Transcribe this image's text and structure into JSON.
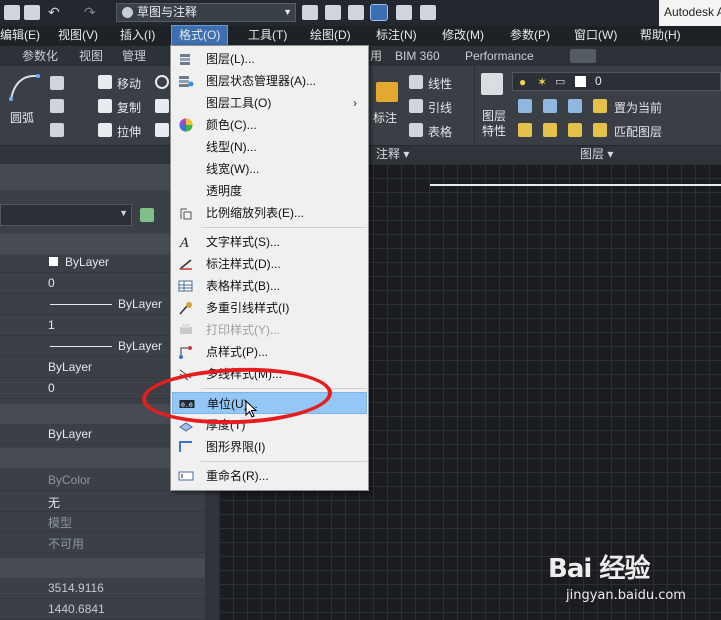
{
  "toolbar": {
    "workspace": "草图与注释",
    "app_title": "Autodesk A"
  },
  "menubar": [
    "编辑(E)",
    "视图(V)",
    "插入(I)",
    "格式(O)",
    "工具(T)",
    "绘图(D)",
    "标注(N)",
    "修改(M)",
    "参数(P)",
    "窗口(W)",
    "帮助(H)"
  ],
  "tabs": [
    "参数化",
    "视图",
    "管理",
    "用",
    "BIM 360",
    "Performance"
  ],
  "ribbon": {
    "arc": "圆弧",
    "move": "移动",
    "copy": "复制",
    "stretch": "拉伸",
    "annotate": "标注",
    "linear": "线性",
    "leader": "引线",
    "table": "表格",
    "layer_props": "图层\n特性",
    "layer_value": "0",
    "set_current": "置为当前",
    "match_layer": "匹配图层",
    "group_annotate": "注释 ▾",
    "group_layer": "图层 ▾"
  },
  "properties": {
    "rows": [
      "ByLayer",
      "0",
      "ByLayer",
      "1",
      "ByLayer",
      "ByLayer",
      "0",
      "ByLayer",
      "ByColor",
      "无",
      "模型",
      "不可用",
      "3514.9116",
      "1440.6841"
    ]
  },
  "format_menu": {
    "items": [
      {
        "label": "图层(L)...",
        "icon": "layer-icon"
      },
      {
        "label": "图层状态管理器(A)...",
        "icon": "layer-state-icon"
      },
      {
        "label": "图层工具(O)",
        "icon": "",
        "submenu": "›"
      },
      {
        "label": "颜色(C)...",
        "icon": "color-wheel-icon"
      },
      {
        "label": "线型(N)...",
        "icon": ""
      },
      {
        "label": "线宽(W)...",
        "icon": ""
      },
      {
        "label": "透明度",
        "icon": ""
      },
      {
        "label": "比例缩放列表(E)...",
        "icon": "scale-list-icon"
      },
      {
        "label": "文字样式(S)...",
        "icon": "text-style-icon"
      },
      {
        "label": "标注样式(D)...",
        "icon": "dim-style-icon"
      },
      {
        "label": "表格样式(B)...",
        "icon": "table-style-icon"
      },
      {
        "label": "多重引线样式(I)",
        "icon": "mleader-style-icon"
      },
      {
        "label": "打印样式(Y)...",
        "icon": "plot-style-icon",
        "disabled": true
      },
      {
        "label": "点样式(P)...",
        "icon": "point-style-icon"
      },
      {
        "label": "多线样式(M)...",
        "icon": "mline-style-icon"
      },
      {
        "label": "单位(U)...",
        "icon": "units-icon",
        "highlighted": true
      },
      {
        "label": "厚度(T)",
        "icon": "thickness-icon"
      },
      {
        "label": "图形界限(I)",
        "icon": "limits-icon"
      },
      {
        "label": "重命名(R)...",
        "icon": "rename-icon"
      }
    ]
  },
  "watermark": {
    "brand": "Bai 经验",
    "url": "jingyan.baidu.com"
  }
}
